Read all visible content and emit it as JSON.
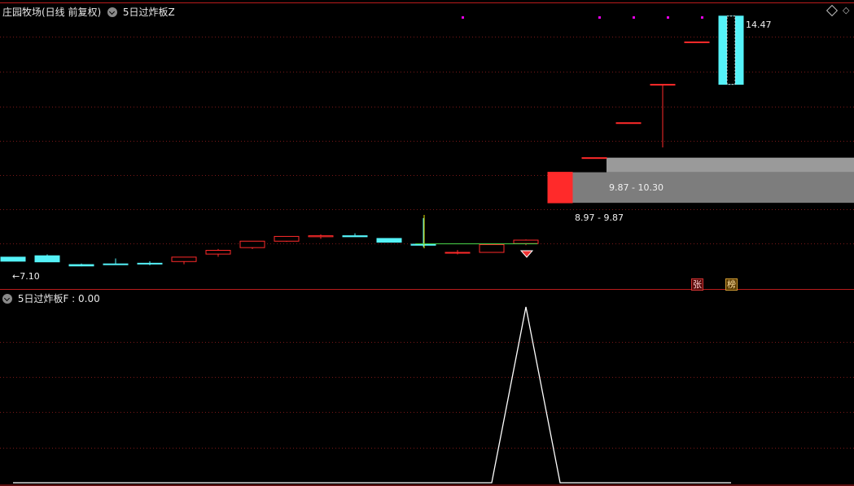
{
  "header": {
    "title": "庄园牧场(日线 前复权)",
    "indicator": "5日过炸板Z"
  },
  "sub_header": {
    "label": "5日过炸板F : 0.00"
  },
  "price_labels": {
    "low": "←7.10",
    "high": "14.47",
    "zone_upper": "9.87 - 10.30",
    "zone_lower": "8.97 - 9.87"
  },
  "badges": {
    "zhang": "张",
    "bang": "榜"
  },
  "icons": {
    "diamond": "diamond-icon",
    "dropdown": "chevron-down-icon",
    "gem": "gem-icon"
  },
  "colors": {
    "up": "#ff2a2a",
    "down": "#55f2f8",
    "grid": "#7a1818",
    "divider": "#b81c1c",
    "signal_line": "#ffffff",
    "zone_upper": "#9a9a9a",
    "zone_lower": "#7d7d7d",
    "marker": "#e800e8"
  },
  "candles": [
    {
      "o": 7.37,
      "c": 7.25,
      "h": 7.37,
      "l": 7.25
    },
    {
      "o": 7.41,
      "c": 7.23,
      "h": 7.45,
      "l": 7.23
    },
    {
      "o": 7.15,
      "c": 7.11,
      "h": 7.18,
      "l": 7.1
    },
    {
      "o": 7.17,
      "c": 7.16,
      "h": 7.33,
      "l": 7.16
    },
    {
      "o": 7.19,
      "c": 7.18,
      "h": 7.25,
      "l": 7.13
    },
    {
      "o": 7.24,
      "c": 7.37,
      "h": 7.37,
      "l": 7.16
    },
    {
      "o": 7.46,
      "c": 7.57,
      "h": 7.61,
      "l": 7.38
    },
    {
      "o": 7.65,
      "c": 7.84,
      "h": 7.84,
      "l": 7.61
    },
    {
      "o": 7.84,
      "c": 7.98,
      "h": 7.98,
      "l": 7.82
    },
    {
      "o": 7.97,
      "c": 8.0,
      "h": 8.04,
      "l": 7.91
    },
    {
      "o": 8.0,
      "c": 7.97,
      "h": 8.07,
      "l": 7.97
    },
    {
      "o": 7.92,
      "c": 7.81,
      "h": 7.93,
      "l": 7.81
    },
    {
      "o": 7.75,
      "c": 7.72,
      "h": 8.52,
      "l": 7.67
    },
    {
      "o": 7.51,
      "c": 7.51,
      "h": 7.58,
      "l": 7.45
    },
    {
      "o": 7.51,
      "c": 7.74,
      "h": 7.74,
      "l": 7.51
    },
    {
      "o": 7.77,
      "c": 7.87,
      "h": 7.89,
      "l": 7.72
    },
    {
      "o": 8.97,
      "c": 9.87,
      "h": 9.87,
      "l": 8.97
    },
    {
      "o": 10.3,
      "c": 10.3,
      "h": 10.3,
      "l": 10.3
    },
    {
      "o": 11.33,
      "c": 11.33,
      "h": 11.33,
      "l": 11.33
    },
    {
      "o": 12.46,
      "c": 12.46,
      "h": 12.46,
      "l": 10.6
    },
    {
      "o": 13.71,
      "c": 13.71,
      "h": 13.71,
      "l": 13.71
    },
    {
      "o": 14.47,
      "c": 12.46,
      "h": 14.47,
      "l": 12.46
    }
  ],
  "signal": [
    0,
    0,
    0,
    0,
    0,
    0,
    0,
    0,
    0,
    0,
    0,
    0,
    0,
    0,
    0,
    1,
    0,
    0,
    0,
    0,
    0,
    0
  ]
}
